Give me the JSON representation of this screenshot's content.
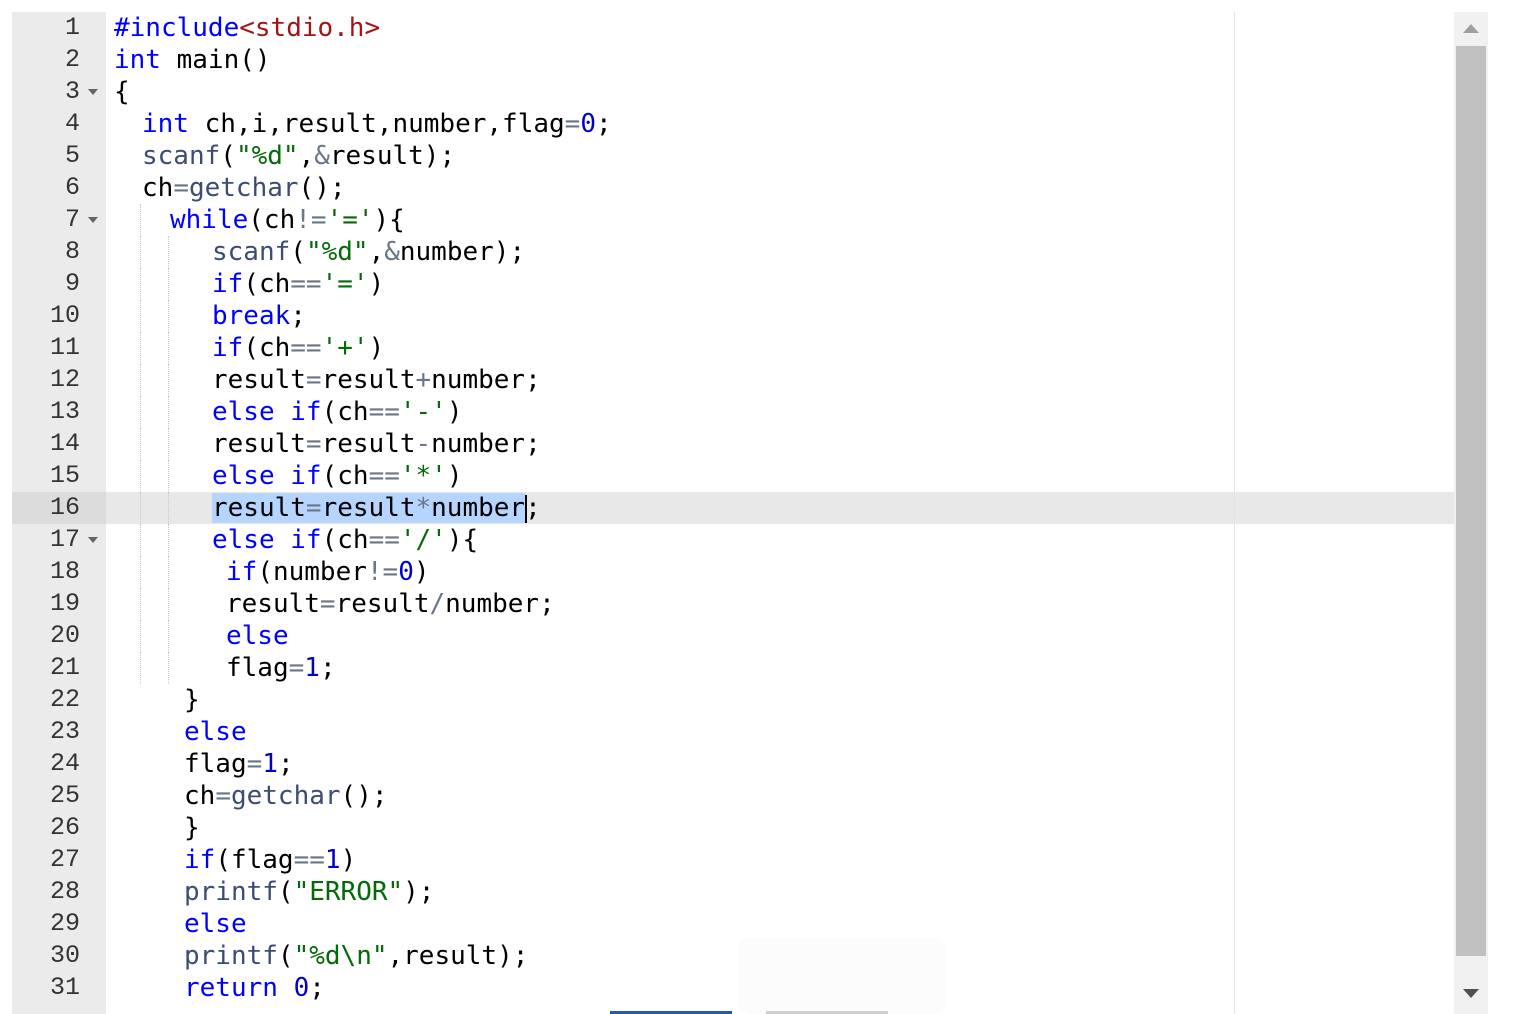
{
  "editor": {
    "language": "c",
    "active_line": 16,
    "lines": [
      {
        "n": "1",
        "fold": false,
        "indent": 0,
        "guides": 0,
        "tokens": [
          {
            "t": "#include",
            "c": "pre"
          },
          {
            "t": "<stdio.h>",
            "c": "hdr"
          }
        ]
      },
      {
        "n": "2",
        "fold": false,
        "indent": 0,
        "guides": 0,
        "tokens": [
          {
            "t": "int",
            "c": "kw"
          },
          {
            "t": " main()",
            "c": ""
          }
        ]
      },
      {
        "n": "3",
        "fold": true,
        "indent": 0,
        "guides": 0,
        "tokens": [
          {
            "t": "{",
            "c": ""
          }
        ]
      },
      {
        "n": "4",
        "fold": false,
        "indent": 1,
        "guides": 0,
        "tokens": [
          {
            "t": "int",
            "c": "kw"
          },
          {
            "t": " ch,i,result,number,flag",
            "c": ""
          },
          {
            "t": "=",
            "c": "op"
          },
          {
            "t": "0",
            "c": "num"
          },
          {
            "t": ";",
            "c": ""
          }
        ]
      },
      {
        "n": "5",
        "fold": false,
        "indent": 1,
        "guides": 0,
        "tokens": [
          {
            "t": "scanf",
            "c": "fn"
          },
          {
            "t": "(",
            "c": ""
          },
          {
            "t": "\"%d\"",
            "c": "str"
          },
          {
            "t": ",",
            "c": ""
          },
          {
            "t": "&",
            "c": "op"
          },
          {
            "t": "result);",
            "c": ""
          }
        ]
      },
      {
        "n": "6",
        "fold": false,
        "indent": 1,
        "guides": 0,
        "tokens": [
          {
            "t": "ch",
            "c": ""
          },
          {
            "t": "=",
            "c": "op"
          },
          {
            "t": "getchar",
            "c": "fn"
          },
          {
            "t": "();",
            "c": ""
          }
        ]
      },
      {
        "n": "7",
        "fold": true,
        "indent": 2,
        "guides": 1,
        "tokens": [
          {
            "t": "while",
            "c": "kw"
          },
          {
            "t": "(ch",
            "c": ""
          },
          {
            "t": "!=",
            "c": "op"
          },
          {
            "t": "'='",
            "c": "str"
          },
          {
            "t": "){",
            "c": ""
          }
        ]
      },
      {
        "n": "8",
        "fold": false,
        "indent": 3.5,
        "guides": 2,
        "tokens": [
          {
            "t": "scanf",
            "c": "fn"
          },
          {
            "t": "(",
            "c": ""
          },
          {
            "t": "\"%d\"",
            "c": "str"
          },
          {
            "t": ",",
            "c": ""
          },
          {
            "t": "&",
            "c": "op"
          },
          {
            "t": "number);",
            "c": ""
          }
        ]
      },
      {
        "n": "9",
        "fold": false,
        "indent": 3.5,
        "guides": 2,
        "tokens": [
          {
            "t": "if",
            "c": "kw"
          },
          {
            "t": "(ch",
            "c": ""
          },
          {
            "t": "==",
            "c": "op"
          },
          {
            "t": "'='",
            "c": "str"
          },
          {
            "t": ")",
            "c": ""
          }
        ]
      },
      {
        "n": "10",
        "fold": false,
        "indent": 3.5,
        "guides": 2,
        "tokens": [
          {
            "t": "break",
            "c": "kw"
          },
          {
            "t": ";",
            "c": ""
          }
        ]
      },
      {
        "n": "11",
        "fold": false,
        "indent": 3.5,
        "guides": 2,
        "tokens": [
          {
            "t": "if",
            "c": "kw"
          },
          {
            "t": "(ch",
            "c": ""
          },
          {
            "t": "==",
            "c": "op"
          },
          {
            "t": "'+'",
            "c": "str"
          },
          {
            "t": ")",
            "c": ""
          }
        ]
      },
      {
        "n": "12",
        "fold": false,
        "indent": 3.5,
        "guides": 2,
        "tokens": [
          {
            "t": "result",
            "c": ""
          },
          {
            "t": "=",
            "c": "op"
          },
          {
            "t": "result",
            "c": ""
          },
          {
            "t": "+",
            "c": "op"
          },
          {
            "t": "number;",
            "c": ""
          }
        ]
      },
      {
        "n": "13",
        "fold": false,
        "indent": 3.5,
        "guides": 2,
        "tokens": [
          {
            "t": "else",
            "c": "kw"
          },
          {
            "t": " ",
            "c": ""
          },
          {
            "t": "if",
            "c": "kw"
          },
          {
            "t": "(ch",
            "c": ""
          },
          {
            "t": "==",
            "c": "op"
          },
          {
            "t": "'-'",
            "c": "str"
          },
          {
            "t": ")",
            "c": ""
          }
        ]
      },
      {
        "n": "14",
        "fold": false,
        "indent": 3.5,
        "guides": 2,
        "tokens": [
          {
            "t": "result",
            "c": ""
          },
          {
            "t": "=",
            "c": "op"
          },
          {
            "t": "result",
            "c": ""
          },
          {
            "t": "-",
            "c": "op"
          },
          {
            "t": "number;",
            "c": ""
          }
        ]
      },
      {
        "n": "15",
        "fold": false,
        "indent": 3.5,
        "guides": 2,
        "tokens": [
          {
            "t": "else",
            "c": "kw"
          },
          {
            "t": " ",
            "c": ""
          },
          {
            "t": "if",
            "c": "kw"
          },
          {
            "t": "(ch",
            "c": ""
          },
          {
            "t": "==",
            "c": "op"
          },
          {
            "t": "'*'",
            "c": "str"
          },
          {
            "t": ")",
            "c": ""
          }
        ]
      },
      {
        "n": "16",
        "fold": false,
        "indent": 3.5,
        "guides": 2,
        "selected": true,
        "tokens": [
          {
            "t": "result",
            "c": ""
          },
          {
            "t": "=",
            "c": "op"
          },
          {
            "t": "result",
            "c": ""
          },
          {
            "t": "*",
            "c": "op"
          },
          {
            "t": "number",
            "c": ""
          }
        ],
        "tail": ";"
      },
      {
        "n": "17",
        "fold": true,
        "indent": 3.5,
        "guides": 2,
        "tokens": [
          {
            "t": "else",
            "c": "kw"
          },
          {
            "t": " ",
            "c": ""
          },
          {
            "t": "if",
            "c": "kw"
          },
          {
            "t": "(ch",
            "c": ""
          },
          {
            "t": "==",
            "c": "op"
          },
          {
            "t": "'/'",
            "c": "str"
          },
          {
            "t": "){",
            "c": ""
          }
        ]
      },
      {
        "n": "18",
        "fold": false,
        "indent": 4,
        "guides": 2,
        "tokens": [
          {
            "t": "if",
            "c": "kw"
          },
          {
            "t": "(number",
            "c": ""
          },
          {
            "t": "!=",
            "c": "op"
          },
          {
            "t": "0",
            "c": "num"
          },
          {
            "t": ")",
            "c": ""
          }
        ]
      },
      {
        "n": "19",
        "fold": false,
        "indent": 4,
        "guides": 2,
        "tokens": [
          {
            "t": "result",
            "c": ""
          },
          {
            "t": "=",
            "c": "op"
          },
          {
            "t": "result",
            "c": ""
          },
          {
            "t": "/",
            "c": "op"
          },
          {
            "t": "number;",
            "c": ""
          }
        ]
      },
      {
        "n": "20",
        "fold": false,
        "indent": 4,
        "guides": 2,
        "tokens": [
          {
            "t": "else",
            "c": "kw"
          }
        ]
      },
      {
        "n": "21",
        "fold": false,
        "indent": 4,
        "guides": 2,
        "tokens": [
          {
            "t": "flag",
            "c": ""
          },
          {
            "t": "=",
            "c": "op"
          },
          {
            "t": "1",
            "c": "num"
          },
          {
            "t": ";",
            "c": ""
          }
        ]
      },
      {
        "n": "22",
        "fold": false,
        "indent": 2.5,
        "guides": 0,
        "tokens": [
          {
            "t": "}",
            "c": ""
          }
        ]
      },
      {
        "n": "23",
        "fold": false,
        "indent": 2.5,
        "guides": 0,
        "tokens": [
          {
            "t": "else",
            "c": "kw"
          }
        ]
      },
      {
        "n": "24",
        "fold": false,
        "indent": 2.5,
        "guides": 0,
        "tokens": [
          {
            "t": "flag",
            "c": ""
          },
          {
            "t": "=",
            "c": "op"
          },
          {
            "t": "1",
            "c": "num"
          },
          {
            "t": ";",
            "c": ""
          }
        ]
      },
      {
        "n": "25",
        "fold": false,
        "indent": 2.5,
        "guides": 0,
        "tokens": [
          {
            "t": "ch",
            "c": ""
          },
          {
            "t": "=",
            "c": "op"
          },
          {
            "t": "getchar",
            "c": "fn"
          },
          {
            "t": "();",
            "c": ""
          }
        ]
      },
      {
        "n": "26",
        "fold": false,
        "indent": 2.5,
        "guides": 0,
        "tokens": [
          {
            "t": "}",
            "c": ""
          }
        ]
      },
      {
        "n": "27",
        "fold": false,
        "indent": 2.5,
        "guides": 0,
        "tokens": [
          {
            "t": "if",
            "c": "kw"
          },
          {
            "t": "(flag",
            "c": ""
          },
          {
            "t": "==",
            "c": "op"
          },
          {
            "t": "1",
            "c": "num"
          },
          {
            "t": ")",
            "c": ""
          }
        ]
      },
      {
        "n": "28",
        "fold": false,
        "indent": 2.5,
        "guides": 0,
        "tokens": [
          {
            "t": "printf",
            "c": "fn"
          },
          {
            "t": "(",
            "c": ""
          },
          {
            "t": "\"ERROR\"",
            "c": "str"
          },
          {
            "t": ");",
            "c": ""
          }
        ]
      },
      {
        "n": "29",
        "fold": false,
        "indent": 2.5,
        "guides": 0,
        "tokens": [
          {
            "t": "else",
            "c": "kw"
          }
        ]
      },
      {
        "n": "30",
        "fold": false,
        "indent": 2.5,
        "guides": 0,
        "tokens": [
          {
            "t": "printf",
            "c": "fn"
          },
          {
            "t": "(",
            "c": ""
          },
          {
            "t": "\"%d\\n\"",
            "c": "str"
          },
          {
            "t": ",result);",
            "c": ""
          }
        ]
      },
      {
        "n": "31",
        "fold": false,
        "indent": 2.5,
        "guides": 0,
        "tokens": [
          {
            "t": "return",
            "c": "kw"
          },
          {
            "t": " ",
            "c": ""
          },
          {
            "t": "0",
            "c": "num"
          },
          {
            "t": ";",
            "c": ""
          }
        ]
      }
    ]
  },
  "colors": {
    "keyword": "#0000ff",
    "function": "#3c4c72",
    "string": "#036a07",
    "number": "#0000cd",
    "gutter_bg": "#ebebeb",
    "active_line_bg": "#e8e8e8",
    "selection": "#b5d5ff"
  },
  "icons": {
    "fold_marker": "chevron-down-icon",
    "scroll_up": "triangle-up-icon",
    "scroll_down": "triangle-down-icon"
  }
}
